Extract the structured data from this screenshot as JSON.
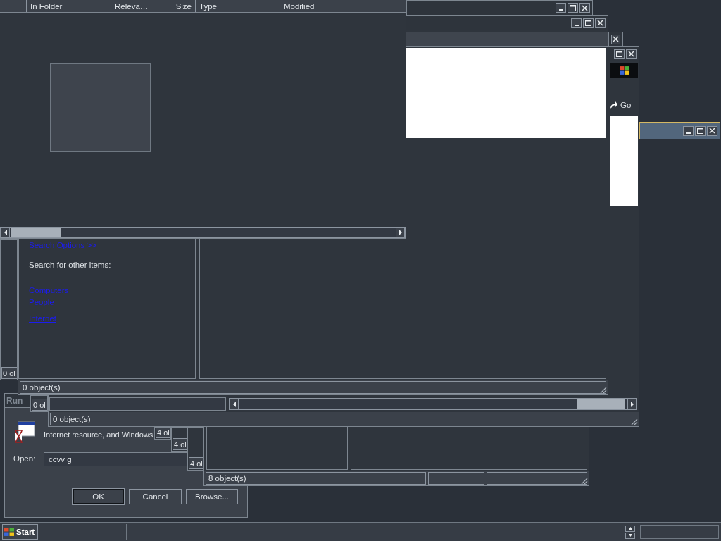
{
  "windows": [
    {
      "kind": "results",
      "columns": [
        {
          "label": "In Folder",
          "kind": "text"
        },
        {
          "label": "Releva…",
          "kind": "text"
        },
        {
          "label": "Size",
          "kind": "numeric"
        },
        {
          "label": "Type",
          "kind": "text"
        },
        {
          "label": "Modified",
          "kind": "text"
        }
      ]
    },
    {
      "kind": "search",
      "active": false,
      "options_link": "Search Options >>",
      "other_heading": "Search for other items:",
      "other_links": [
        "Computers",
        "People"
      ],
      "more_links": [
        "Internet"
      ],
      "status": "0 object(s)"
    },
    {
      "kind": "browser",
      "active": false,
      "go_label": "Go",
      "status": "0 object(s)"
    },
    {
      "kind": "frame",
      "active": false
    },
    {
      "kind": "frame",
      "active": false
    },
    {
      "kind": "panes",
      "status": "8 object(s)"
    },
    {
      "kind": "stub",
      "status": "4 ol"
    },
    {
      "kind": "stub",
      "status": "4 ol"
    },
    {
      "kind": "stub",
      "status": "4 ol"
    },
    {
      "kind": "stub",
      "status": "0 ol"
    },
    {
      "kind": "stub",
      "status": "0 ol"
    },
    {
      "kind": "run",
      "active": false,
      "title": "Run",
      "prompt": "Internet resource, and Windows",
      "open_label": "Open:",
      "open_value": "ccvv g",
      "buttons": [
        {
          "label": "OK",
          "default": true
        },
        {
          "label": "Cancel",
          "default": false
        },
        {
          "label": "Browse...",
          "default": false
        }
      ]
    },
    {
      "kind": "frame",
      "active": true
    }
  ],
  "taskbar": {
    "start_label": "Start"
  }
}
